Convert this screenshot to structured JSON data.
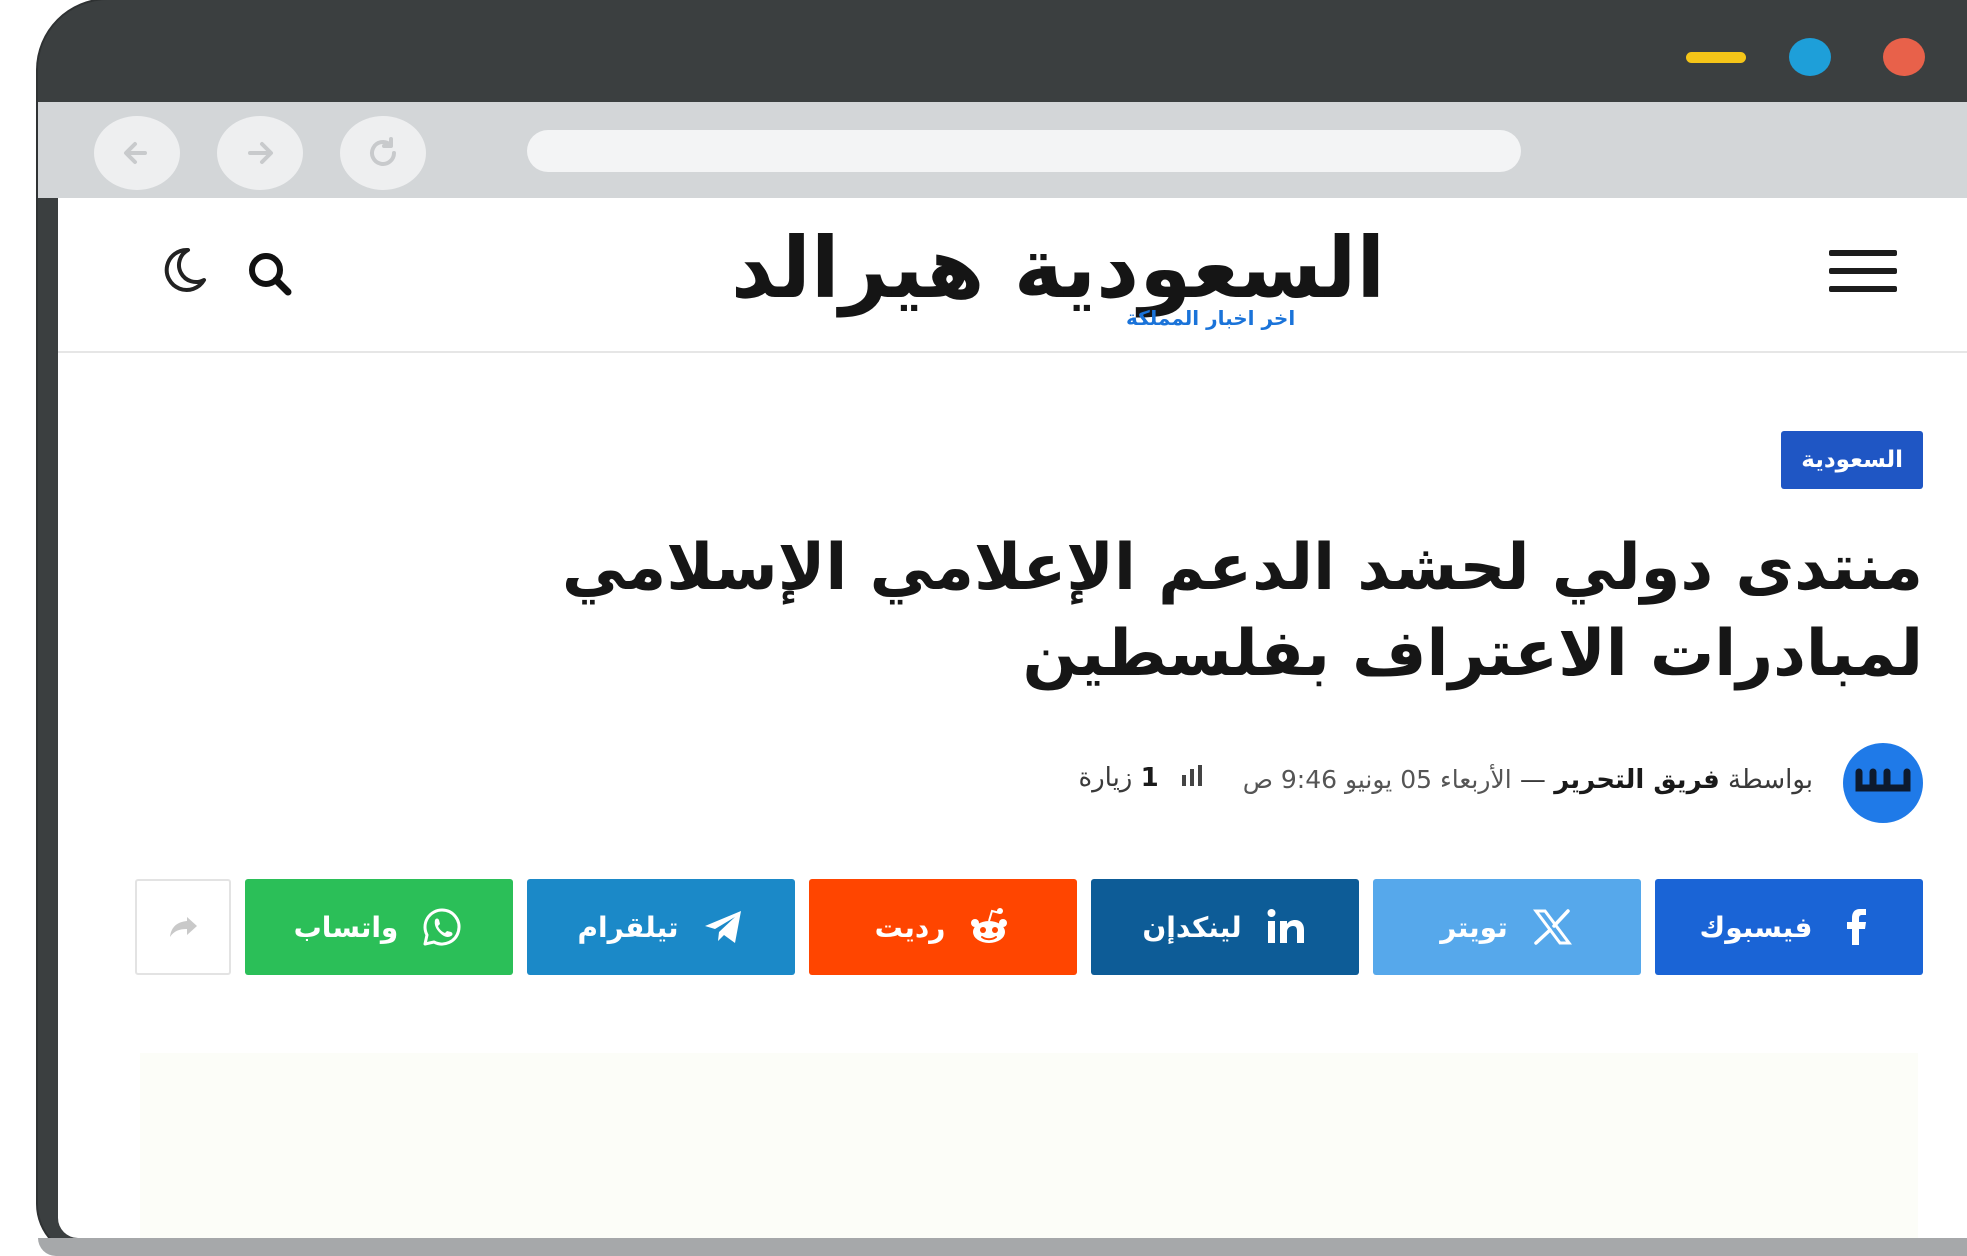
{
  "colors": {
    "frame": "#3b3f40",
    "toolbar": "#d3d6d8",
    "window_red": "#e8614a",
    "window_blue": "#1e9fd9",
    "window_yellow": "#f5c518",
    "category_badge": "#1f56c4",
    "facebook": "#1a64d6",
    "twitter": "#56a8eb",
    "linkedin": "#0d5c97",
    "reddit": "#ff4500",
    "telegram": "#1b89c8",
    "whatsapp": "#2bbf58",
    "logo_accent": "#1a73d9"
  },
  "browser": {
    "back_icon": "arrow-left-icon",
    "forward_icon": "arrow-right-icon",
    "reload_icon": "reload-icon"
  },
  "site": {
    "logo_text": "السعودية هيرالد",
    "logo_tagline": "اخر اخبار المملكة",
    "menu_icon": "hamburger-icon",
    "search_icon": "search-icon",
    "theme_icon": "moon-icon"
  },
  "article": {
    "category": "السعودية",
    "title": "منتدى دولي لحشد الدعم الإعلامي الإسلامي لمبادرات الاعتراف بفلسطين",
    "by_label": "بواسطة",
    "author": "فريق التحرير",
    "separator": "—",
    "date": "الأربعاء 05 يونيو 9:46 ص",
    "views_count": "1",
    "views_label": "زيارة"
  },
  "share": {
    "buttons": [
      {
        "label": "فيسبوك",
        "icon": "facebook-icon"
      },
      {
        "label": "تويتر",
        "icon": "x-twitter-icon"
      },
      {
        "label": "لينكدإن",
        "icon": "linkedin-icon"
      },
      {
        "label": "رديت",
        "icon": "reddit-icon"
      },
      {
        "label": "تيلقرام",
        "icon": "telegram-icon"
      },
      {
        "label": "واتساب",
        "icon": "whatsapp-icon"
      }
    ],
    "more_icon": "share-arrow-icon"
  }
}
